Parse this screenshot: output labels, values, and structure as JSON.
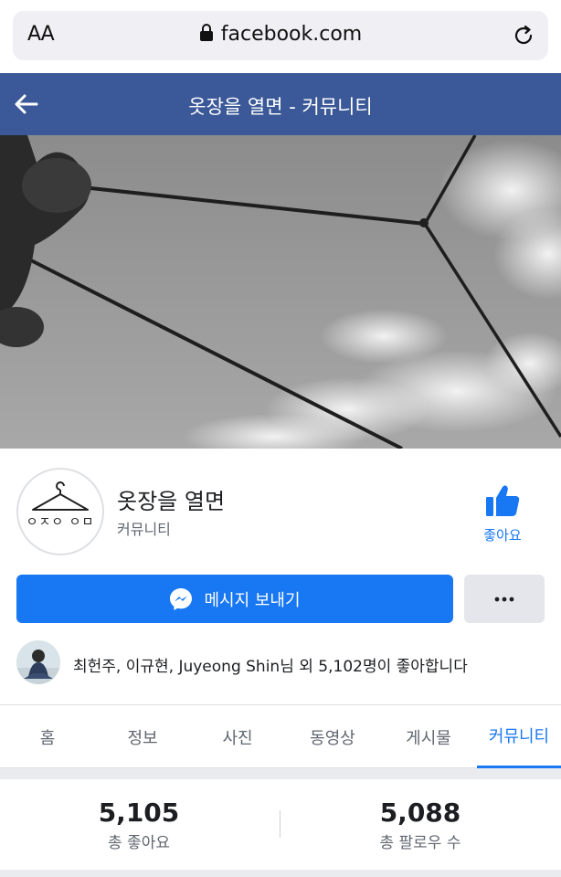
{
  "browser": {
    "text_size_label": "AA",
    "url": "facebook.com"
  },
  "header": {
    "title": "옷장을 열면 - 커뮤니티"
  },
  "page": {
    "name": "옷장을 열면",
    "category": "커뮤니티",
    "like_label": "좋아요",
    "accent_color": "#1877f2",
    "header_color": "#3b5998"
  },
  "actions": {
    "message_label": "메시지 보내기",
    "more_label": "•••"
  },
  "friends": {
    "text": "최헌주, 이규현, Juyeong Shin님 외 5,102명이 좋아합니다"
  },
  "tabs": [
    {
      "label": "홈",
      "active": false
    },
    {
      "label": "정보",
      "active": false
    },
    {
      "label": "사진",
      "active": false
    },
    {
      "label": "동영상",
      "active": false
    },
    {
      "label": "게시물",
      "active": false
    },
    {
      "label": "커뮤니티",
      "active": true
    }
  ],
  "stats": {
    "likes_value": "5,105",
    "likes_label": "총 좋아요",
    "followers_value": "5,088",
    "followers_label": "총 팔로우 수"
  },
  "icons": [
    "lock-icon",
    "reload-icon",
    "back-arrow-icon",
    "thumbs-up-icon",
    "messenger-icon",
    "more-icon",
    "hanger-logo-icon"
  ]
}
